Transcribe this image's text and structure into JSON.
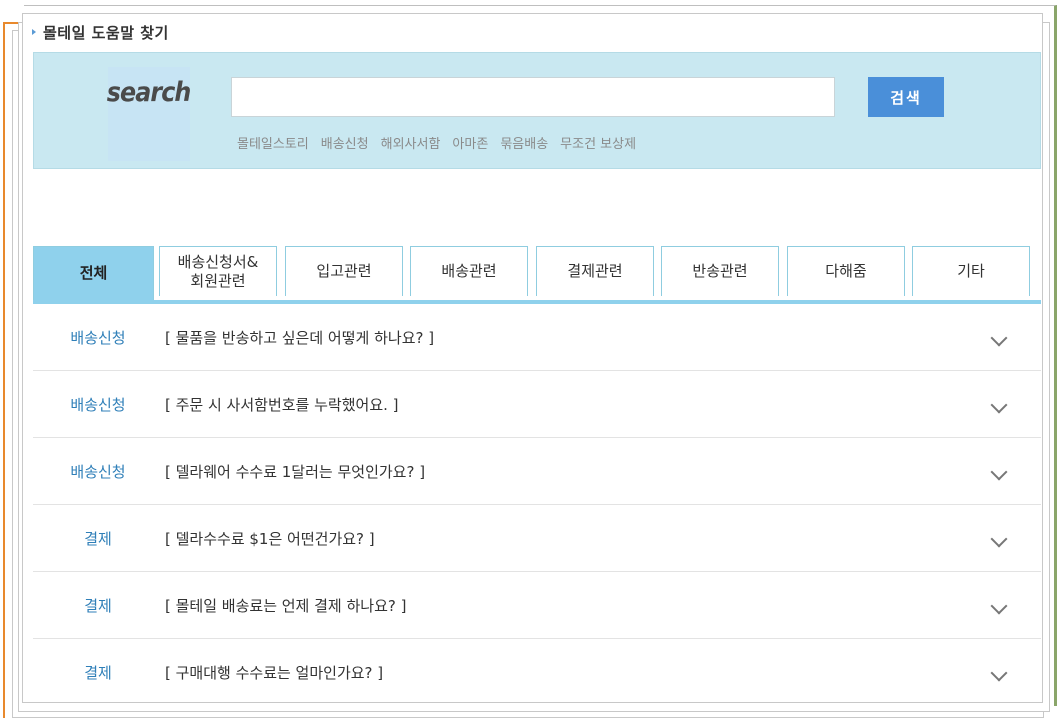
{
  "header": {
    "title": "몰테일 도움말 찾기"
  },
  "search": {
    "logo_text": "search",
    "input_value": "",
    "button_label": "검색",
    "keywords": [
      "몰테일스토리",
      "배송신청",
      "해외사서함",
      "아마존",
      "묶음배송",
      "무조건 보상제"
    ]
  },
  "tabs": [
    {
      "label": "전체",
      "active": true
    },
    {
      "label": "배송신청서&\n회원관련",
      "active": false
    },
    {
      "label": "입고관련",
      "active": false
    },
    {
      "label": "배송관련",
      "active": false
    },
    {
      "label": "결제관련",
      "active": false
    },
    {
      "label": "반송관련",
      "active": false
    },
    {
      "label": "다해줌",
      "active": false
    },
    {
      "label": "기타",
      "active": false
    }
  ],
  "faq": [
    {
      "category": "배송신청",
      "question": "[ 물품을 반송하고 싶은데 어떻게 하나요? ]"
    },
    {
      "category": "배송신청",
      "question": "[ 주문 시 사서함번호를 누락했어요. ]"
    },
    {
      "category": "배송신청",
      "question": "[ 델라웨어 수수료 1달러는 무엇인가요? ]"
    },
    {
      "category": "결제",
      "question": "[ 델라수수료 $1은 어떤건가요? ]"
    },
    {
      "category": "결제",
      "question": "[ 몰테일 배송료는 언제 결제 하나요? ]"
    },
    {
      "category": "결제",
      "question": "[ 구매대행 수수료는 얼마인가요? ]"
    }
  ],
  "colors": {
    "accent": "#8fd1ec",
    "button": "#4a8fd9",
    "category": "#2f7fb8",
    "search_bg": "#c9e8f1"
  }
}
